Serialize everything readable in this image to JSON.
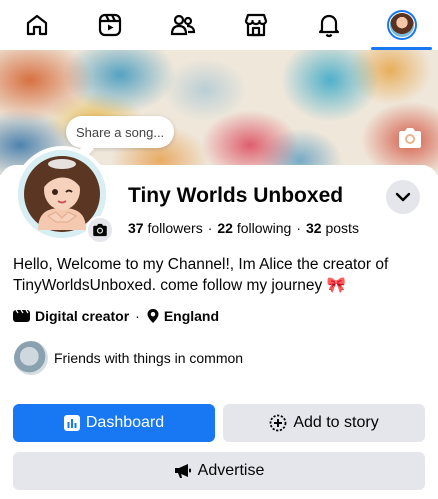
{
  "nav": {
    "items": [
      {
        "name": "home",
        "icon": "home-icon"
      },
      {
        "name": "video",
        "icon": "video-icon"
      },
      {
        "name": "friends",
        "icon": "friends-icon"
      },
      {
        "name": "marketplace",
        "icon": "store-icon"
      },
      {
        "name": "notifications",
        "icon": "bell-icon"
      },
      {
        "name": "profile",
        "icon": "profile-avatar",
        "active": true
      }
    ]
  },
  "cover": {
    "song_prompt": "Share a song..."
  },
  "profile": {
    "name": "Tiny Worlds Unboxed",
    "followers_count": "37",
    "followers_label": "followers",
    "following_count": "22",
    "following_label": "following",
    "posts_count": "32",
    "posts_label": "posts",
    "bio": "Hello, Welcome to my Channel!, Im Alice the creator of TinyWorldsUnboxed. come follow my journey 🎀",
    "category": "Digital creator",
    "location": "England",
    "friends_common": "Friends with things in common"
  },
  "actions": {
    "dashboard": "Dashboard",
    "add_story": "Add to story",
    "advertise": "Advertise"
  },
  "colors": {
    "accent": "#1877f2",
    "button_gray": "#e4e6eb",
    "text": "#050505"
  }
}
